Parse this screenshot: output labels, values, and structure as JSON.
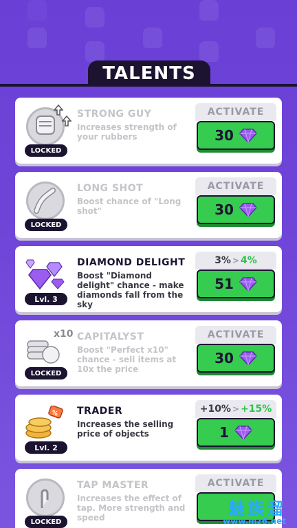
{
  "header": {
    "title": "TALENTS"
  },
  "colors": {
    "accent_green": "#35cc4f",
    "background": "#6a3fd6",
    "gem": "#9b5cf0"
  },
  "talents": [
    {
      "name": "STRONG GUY",
      "description": "Increases strength of your rubbers",
      "status": "LOCKED",
      "action_label": "ACTIVATE",
      "price": "30",
      "icon": "fist-icon",
      "locked": true
    },
    {
      "name": "LONG SHOT",
      "description": "Boost chance of \"Long shot\"",
      "status": "LOCKED",
      "action_label": "ACTIVATE",
      "price": "30",
      "icon": "long-arm-icon",
      "locked": true
    },
    {
      "name": "DIAMOND DELIGHT",
      "description": "Boost \"Diamond delight\" chance - make diamonds fall from the sky",
      "status": "Lvl. 3",
      "current_value": "3%",
      "next_value": "4%",
      "price": "51",
      "icon": "diamonds-icon",
      "locked": false
    },
    {
      "name": "CAPITALYST",
      "description": "Boost \"Perfect x10\" chance - sell items at 10x the price",
      "status": "LOCKED",
      "action_label": "ACTIVATE",
      "price": "30",
      "icon": "silver-coins-icon",
      "multiplier": "x10",
      "locked": true
    },
    {
      "name": "TRADER",
      "description": "Increases the selling price of objects",
      "status": "Lvl. 2",
      "current_value": "+10%",
      "next_value": "+15%",
      "price": "1",
      "icon": "gold-coins-icon",
      "locked": false
    },
    {
      "name": "TAP MASTER",
      "description": "Increases the effect of tap. More strength and speed",
      "status": "LOCKED",
      "action_label": "ACTIVATE",
      "price": "",
      "icon": "tap-hand-icon",
      "locked": true
    }
  ],
  "watermark": {
    "text": "魅族溜",
    "url": "www.mz6.net"
  }
}
